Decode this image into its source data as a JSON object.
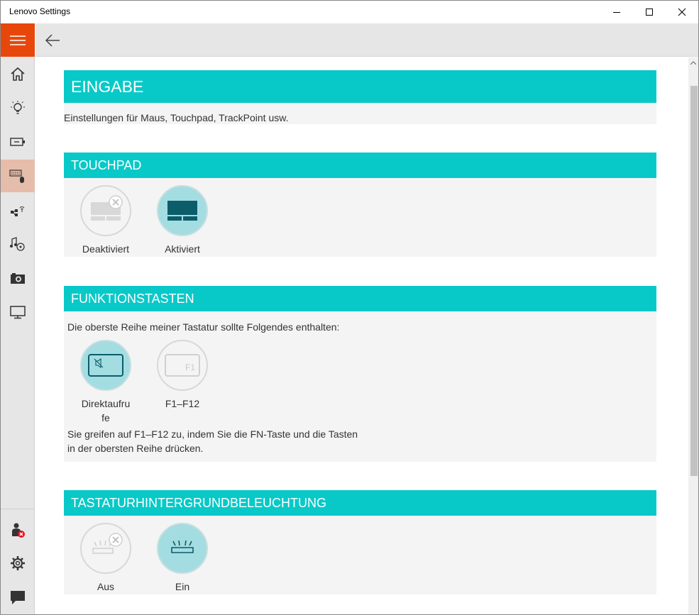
{
  "window": {
    "title": "Lenovo Settings"
  },
  "sidebar": {
    "items": [
      {
        "icon": "home-icon"
      },
      {
        "icon": "lightbulb-icon"
      },
      {
        "icon": "battery-icon"
      },
      {
        "icon": "keyboard-mouse-icon",
        "active": true
      },
      {
        "icon": "network-icon"
      },
      {
        "icon": "audio-video-icon"
      },
      {
        "icon": "camera-icon"
      },
      {
        "icon": "display-icon"
      }
    ],
    "bottom_items": [
      {
        "icon": "account-error-icon"
      },
      {
        "icon": "settings-gear-icon"
      },
      {
        "icon": "feedback-icon"
      }
    ]
  },
  "page": {
    "title": "EINGABE",
    "description": "Einstellungen für Maus, Touchpad, TrackPoint usw."
  },
  "touchpad": {
    "title": "TOUCHPAD",
    "options": [
      {
        "label": "Deaktiviert",
        "selected": false
      },
      {
        "label": "Aktiviert",
        "selected": true
      }
    ]
  },
  "function_keys": {
    "title": "FUNKTIONSTASTEN",
    "intro": "Die oberste Reihe meiner Tastatur sollte Folgendes enthalten:",
    "options": [
      {
        "label": "Direktaufrufe",
        "label_line1": "Direktaufru",
        "label_line2": "fe",
        "selected": true
      },
      {
        "label": "F1–F12",
        "key_text": "F1",
        "selected": false
      }
    ],
    "note_line1": "Sie greifen auf F1–F12 zu, indem Sie die FN-Taste und die Tasten",
    "note_line2": "in der obersten Reihe drücken."
  },
  "backlight": {
    "title": "TASTATURHINTERGRUNDBELEUCHTUNG",
    "options": [
      {
        "label": "Aus",
        "selected": false
      },
      {
        "label": "Ein",
        "selected": true
      }
    ]
  },
  "colors": {
    "accent": "#08c9c8",
    "hamburger": "#e8470c",
    "active_nav": "#e6bcaa",
    "selected_circle": "#a4dde1"
  }
}
